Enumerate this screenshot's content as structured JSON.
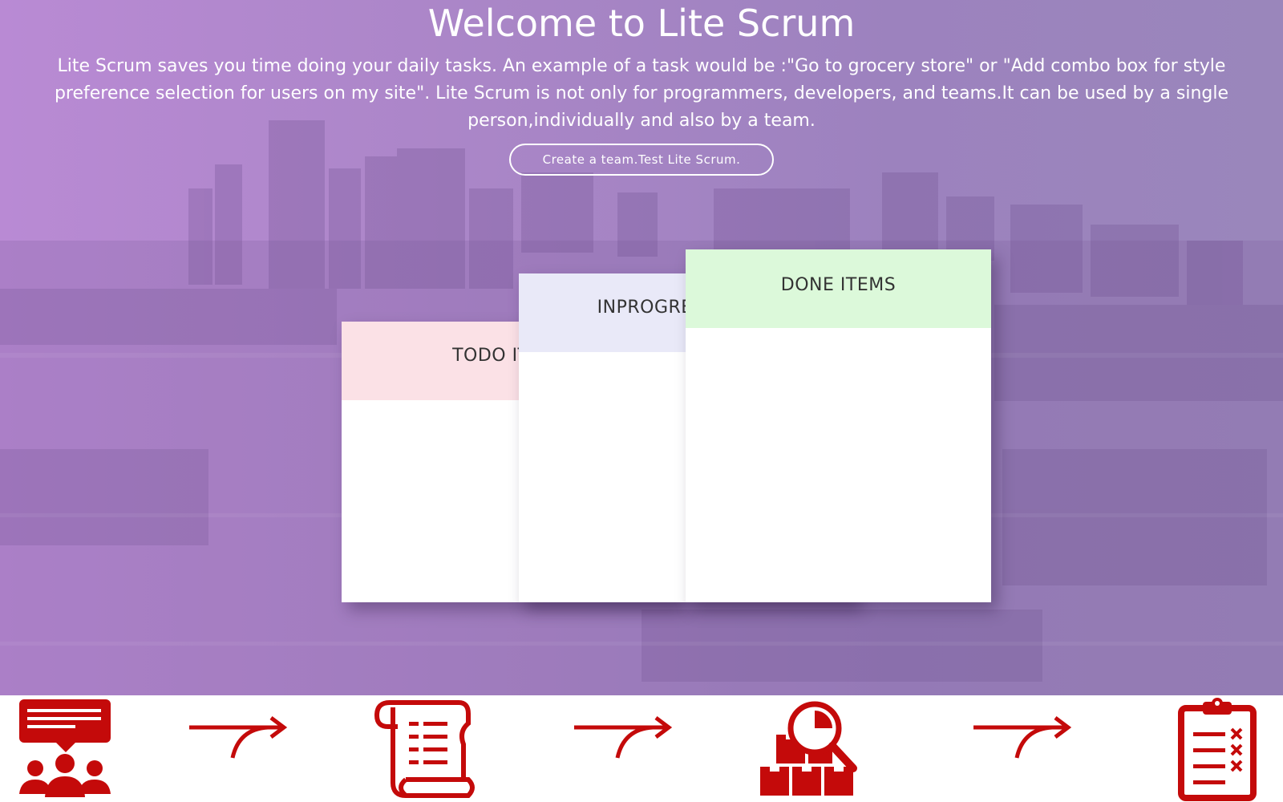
{
  "hero": {
    "title": "Welcome to Lite Scrum",
    "intro": "Lite Scrum saves you time doing your daily tasks. An example of a task would be :\"Go to grocery store\" or \"Add combo box for style preference selection for users on my site\". Lite Scrum is not only for programmers, developers, and teams.It can be used by a single person,individually and also by a team.",
    "cta_label": "Create a team.Test Lite Scrum."
  },
  "board": {
    "todo_title": "TODO ITEMS",
    "inprogress_title": "INPROGRESS ITEMS",
    "done_title": "DONE ITEMS"
  },
  "steps": {
    "icons": [
      "team-meeting-icon",
      "product-backlog-scroll-icon",
      "sprint-review-boxes-magnifier-icon",
      "checklist-clipboard-icon"
    ],
    "connector": "curved-arrow-icon"
  },
  "colors": {
    "hero_purple": "#a685c6",
    "todo_header": "#fbe1e6",
    "inprogress_header": "#e9e9f8",
    "done_header": "#dcf9da",
    "icon_red": "#c40a0a"
  }
}
